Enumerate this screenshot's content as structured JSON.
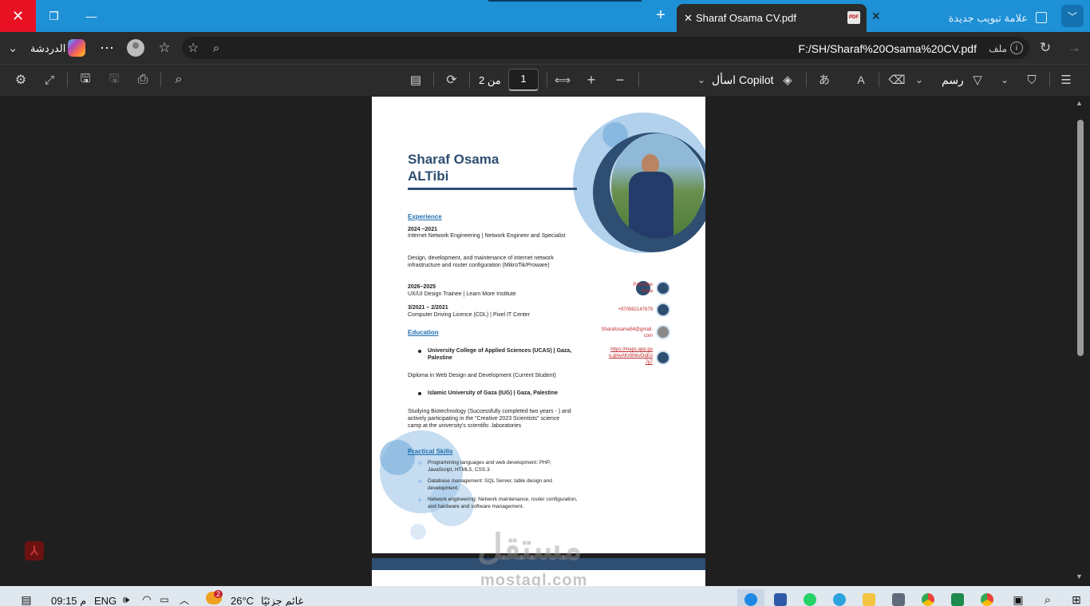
{
  "browser": {
    "active_tab_title": "Sharaf Osama CV.pdf",
    "inactive_tab_title": "علامة تبويب جديدة",
    "address_label": "ملف",
    "url": "F:/SH/Sharaf%20Osama%20CV.pdf",
    "copilot_chat_label": "الدردشة"
  },
  "pdf_toolbar": {
    "current_page": "1",
    "page_of_label": "من 2",
    "ask_copilot_label": "اسأل Copilot",
    "draw_label": "رسم"
  },
  "cv": {
    "name_line1": "Sharaf Osama",
    "name_line2": "ALTibi",
    "experience_heading": "Experience",
    "exp1_date": "2024 –2021",
    "exp1_title": "Internet Network Engineering | Network Engineer and Specialist",
    "exp1_desc": "Design, development, and maintenance of internet network infrastructure and router configuration (MikroTik/Proware)",
    "exp2_date": "2026–2025",
    "exp2_title": "UX/UI Design Trainee | Learn More Institute",
    "exp3_date": "3/2021 – 2/2021",
    "exp3_title": "Computer Driving Licence (CDL) | Pixel IT Center",
    "education_heading": "Education",
    "edu1_school": "University College of Applied Sciences (UCAS) | Gaza, Palestine",
    "edu1_desc": "Diploma in Web Design and Development (Current Student)",
    "edu2_school": "Islamic University of Gaza (IUG) | Gaza, Palestine",
    "edu2_desc": "Studying Biotechnology (Successfully completed two years - ) and actively participating in the \"Creative 2023 Scientists\" science camp at the university's scientific .laboratories",
    "skills_heading": "Practical Skills",
    "skill1": "Programming languages and web development: PHP, JavaScript, HTML5, CSS.3",
    "skill2": "Database management: SQL Server, table design and development.",
    "skill3": "Network engineering: Network maintenance, router configuration, and hardware and software management.",
    "contact_location_1": "Palestine",
    "contact_location_2": "Gaza",
    "contact_phone": "+970592147679",
    "contact_email_1": "Sharafosama54@gmail.",
    "contact_email_2": "com",
    "contact_map_1": "https://maps.app.go",
    "contact_map_2": "o.gl/wAKrt8hkvDqEo",
    "contact_map_3": "7jj7"
  },
  "watermark": {
    "arabic": "مستقل",
    "latin": "mostaql.com"
  },
  "taskbar": {
    "time": "09:15 م",
    "language": "ENG",
    "temperature": "26°C",
    "weather": "غائم جزئيًا",
    "weather_badge": "2"
  },
  "colors": {
    "titlebar": "#1e90d6",
    "cv_accent": "#2e4e72",
    "cv_link": "#1f6fb2",
    "contact_red": "#c0282c"
  }
}
